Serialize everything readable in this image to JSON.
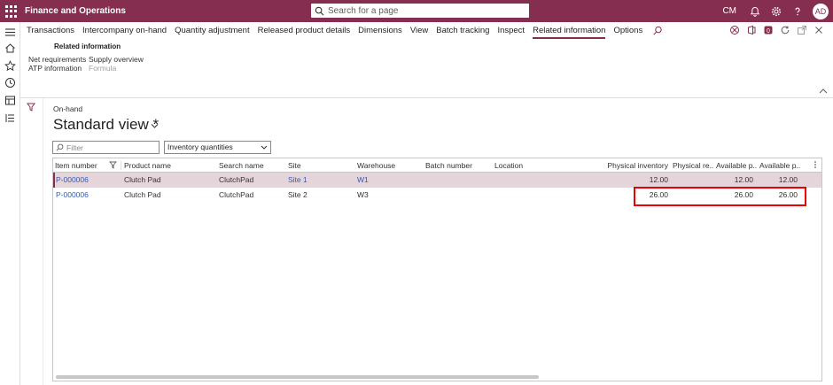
{
  "topbar": {
    "app_title": "Finance and Operations",
    "search_placeholder": "Search for a page",
    "company": "CM",
    "user_initials": "AD"
  },
  "action_tabs": [
    "Transactions",
    "Intercompany on-hand",
    "Quantity adjustment",
    "Released product details",
    "Dimensions",
    "View",
    "Batch tracking",
    "Inspect",
    "Related information",
    "Options"
  ],
  "active_tab": "Related information",
  "notification_badge": "0",
  "related_info": {
    "group_title": "Related information",
    "net_requirements": "Net requirements",
    "supply_overview": "Supply overview",
    "atp_information": "ATP information",
    "formula": "Formula"
  },
  "page": {
    "caption": "On-hand",
    "view_name": "Standard view *",
    "filter_placeholder": "Filter",
    "dimension_select": "Inventory quantities"
  },
  "grid": {
    "columns": [
      "Item number",
      "Product name",
      "Search name",
      "Site",
      "Warehouse",
      "Batch number",
      "Location",
      "Physical inventory",
      "Physical re...",
      "Available p...",
      "Available p..."
    ],
    "rows": [
      {
        "item": "P-000006",
        "product": "Clutch Pad",
        "search": "ClutchPad",
        "site": "Site 1",
        "warehouse": "W1",
        "batch": "",
        "location": "",
        "physical": "12.00",
        "phys_reserved": "",
        "avail1": "12.00",
        "avail2": "12.00"
      },
      {
        "item": "P-000006",
        "product": "Clutch Pad",
        "search": "ClutchPad",
        "site": "Site 2",
        "warehouse": "W3",
        "batch": "",
        "location": "",
        "physical": "26.00",
        "phys_reserved": "",
        "avail1": "26.00",
        "avail2": "26.00"
      }
    ]
  },
  "colors": {
    "brand": "#862e4f",
    "link": "#2f5bb7",
    "selected_row": "#e6d4db",
    "highlight_box": "#e00000"
  }
}
